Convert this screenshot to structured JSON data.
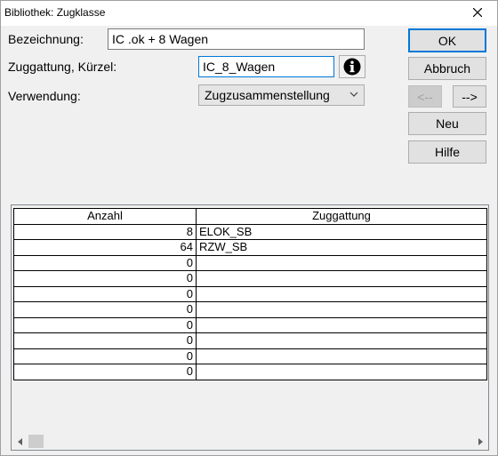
{
  "window": {
    "title": "Bibliothek: Zugklasse",
    "close_symbol": "close-icon"
  },
  "form": {
    "bezeichnung_label": "Bezeichnung:",
    "bezeichnung_value": "IC .ok + 8 Wagen",
    "kuerzel_label": "Zuggattung, Kürzel:",
    "kuerzel_value": "IC_8_Wagen",
    "verwendung_label": "Verwendung:",
    "verwendung_value": "Zugzusammenstellung"
  },
  "buttons": {
    "ok": "OK",
    "abbruch": "Abbruch",
    "prev": "<--",
    "next": "-->",
    "neu": "Neu",
    "hilfe": "Hilfe"
  },
  "table": {
    "headers": [
      "Anzahl",
      "Zuggattung"
    ],
    "rows": [
      [
        "8",
        "ELOK_SB"
      ],
      [
        "64",
        "RZW_SB"
      ],
      [
        "0",
        ""
      ],
      [
        "0",
        ""
      ],
      [
        "0",
        ""
      ],
      [
        "0",
        ""
      ],
      [
        "0",
        ""
      ],
      [
        "0",
        ""
      ],
      [
        "0",
        ""
      ],
      [
        "0",
        ""
      ]
    ]
  },
  "colors": {
    "accent": "#0078d7",
    "window_bg": "#f0f0f0",
    "button_bg": "#e1e1e1"
  }
}
